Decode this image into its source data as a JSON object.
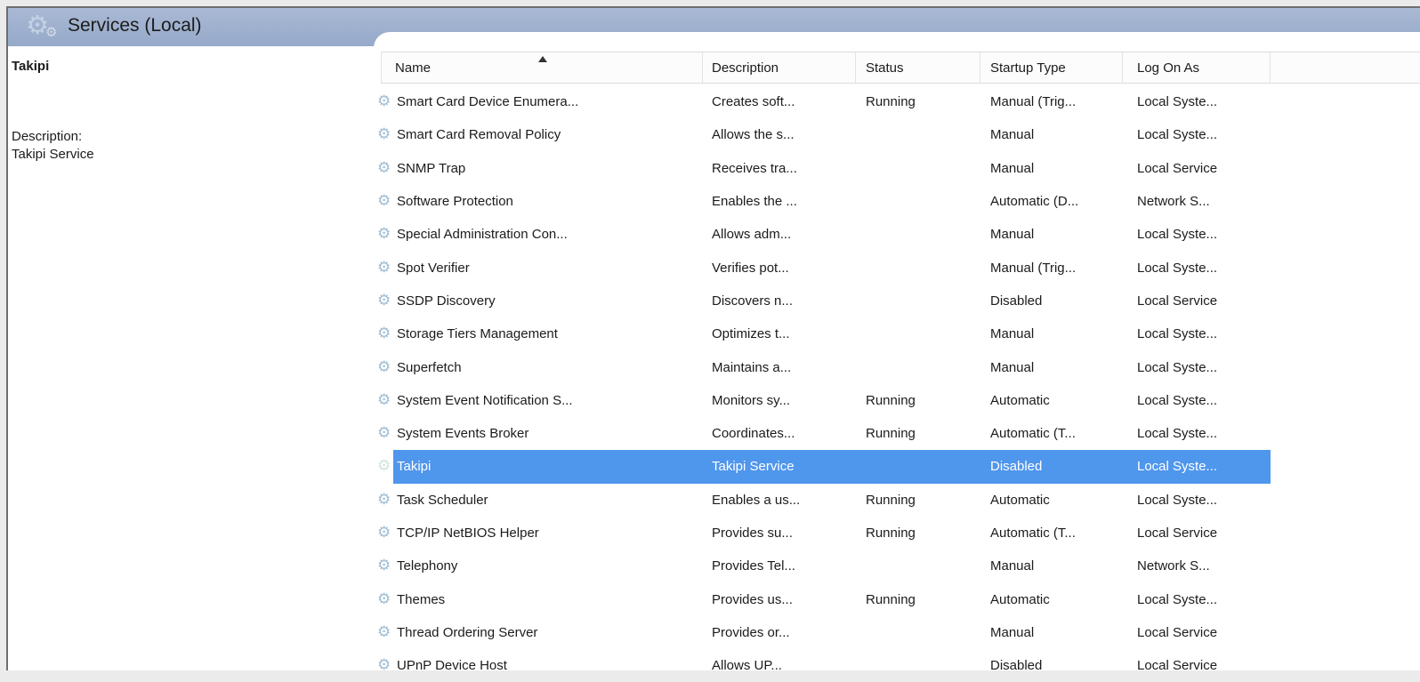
{
  "header": {
    "title": "Services (Local)",
    "logo_icon": "services-gear-icon"
  },
  "left_panel": {
    "service_name": "Takipi",
    "description_label": "Description:",
    "description_text": "Takipi Service"
  },
  "table": {
    "columns": [
      {
        "label": "Name",
        "sort": "ascending"
      },
      {
        "label": "Description"
      },
      {
        "label": "Status"
      },
      {
        "label": "Startup Type"
      },
      {
        "label": "Log On As"
      }
    ],
    "rows": [
      {
        "name": "Smart Card Device Enumera...",
        "description": "Creates soft...",
        "status": "Running",
        "startup_type": "Manual (Trig...",
        "log_on_as": "Local Syste...",
        "selected": false
      },
      {
        "name": "Smart Card Removal Policy",
        "description": "Allows the s...",
        "status": "",
        "startup_type": "Manual",
        "log_on_as": "Local Syste...",
        "selected": false
      },
      {
        "name": "SNMP Trap",
        "description": "Receives tra...",
        "status": "",
        "startup_type": "Manual",
        "log_on_as": "Local Service",
        "selected": false
      },
      {
        "name": "Software Protection",
        "description": "Enables the ...",
        "status": "",
        "startup_type": "Automatic (D...",
        "log_on_as": "Network S...",
        "selected": false
      },
      {
        "name": "Special Administration Con...",
        "description": "Allows adm...",
        "status": "",
        "startup_type": "Manual",
        "log_on_as": "Local Syste...",
        "selected": false
      },
      {
        "name": "Spot Verifier",
        "description": "Verifies pot...",
        "status": "",
        "startup_type": "Manual (Trig...",
        "log_on_as": "Local Syste...",
        "selected": false
      },
      {
        "name": "SSDP Discovery",
        "description": "Discovers n...",
        "status": "",
        "startup_type": "Disabled",
        "log_on_as": "Local Service",
        "selected": false
      },
      {
        "name": "Storage Tiers Management",
        "description": "Optimizes t...",
        "status": "",
        "startup_type": "Manual",
        "log_on_as": "Local Syste...",
        "selected": false
      },
      {
        "name": "Superfetch",
        "description": "Maintains a...",
        "status": "",
        "startup_type": "Manual",
        "log_on_as": "Local Syste...",
        "selected": false
      },
      {
        "name": "System Event Notification S...",
        "description": "Monitors sy...",
        "status": "Running",
        "startup_type": "Automatic",
        "log_on_as": "Local Syste...",
        "selected": false
      },
      {
        "name": "System Events Broker",
        "description": "Coordinates...",
        "status": "Running",
        "startup_type": "Automatic (T...",
        "log_on_as": "Local Syste...",
        "selected": false
      },
      {
        "name": "Takipi",
        "description": "Takipi Service",
        "status": "",
        "startup_type": "Disabled",
        "log_on_as": "Local Syste...",
        "selected": true
      },
      {
        "name": "Task Scheduler",
        "description": "Enables a us...",
        "status": "Running",
        "startup_type": "Automatic",
        "log_on_as": "Local Syste...",
        "selected": false
      },
      {
        "name": "TCP/IP NetBIOS Helper",
        "description": "Provides su...",
        "status": "Running",
        "startup_type": "Automatic (T...",
        "log_on_as": "Local Service",
        "selected": false
      },
      {
        "name": "Telephony",
        "description": "Provides Tel...",
        "status": "",
        "startup_type": "Manual",
        "log_on_as": "Network S...",
        "selected": false
      },
      {
        "name": "Themes",
        "description": "Provides us...",
        "status": "Running",
        "startup_type": "Automatic",
        "log_on_as": "Local Syste...",
        "selected": false
      },
      {
        "name": "Thread Ordering Server",
        "description": "Provides or...",
        "status": "",
        "startup_type": "Manual",
        "log_on_as": "Local Service",
        "selected": false
      },
      {
        "name": "UPnP Device Host",
        "description": "Allows UP...",
        "status": "",
        "startup_type": "Disabled",
        "log_on_as": "Local Service",
        "selected": false
      }
    ]
  },
  "icons": {
    "row_icon": "gear-icon",
    "gear_glyph": "⚙",
    "sort_icon": "sort-ascending-icon"
  },
  "colors": {
    "band_blue": "#9eb0ce",
    "selection_blue": "#4f96ed",
    "window_border": "#6e6e6e",
    "gear_blue": "#9fbdd3",
    "text": "#1b1b1b"
  }
}
